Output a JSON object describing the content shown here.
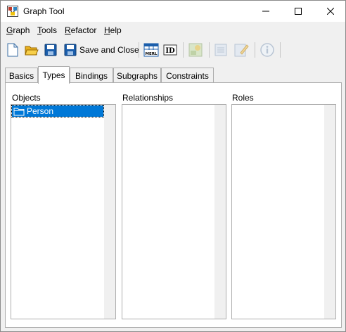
{
  "window": {
    "title": "Graph Tool"
  },
  "menu": [
    {
      "accel": "G",
      "rest": "raph"
    },
    {
      "accel": "T",
      "rest": "ools"
    },
    {
      "accel": "R",
      "rest": "efactor"
    },
    {
      "accel": "H",
      "rest": "elp"
    }
  ],
  "toolbar": {
    "save_close_label": "Save and Close"
  },
  "tabs": [
    "Basics",
    "Types",
    "Bindings",
    "Subgraphs",
    "Constraints"
  ],
  "active_tab": "Types",
  "panel": {
    "objects_label": "Objects",
    "relationships_label": "Relationships",
    "roles_label": "Roles",
    "objects": [
      "Person"
    ],
    "relationships": [],
    "roles": []
  },
  "colors": {
    "selection": "#0078d7",
    "accent_blue": "#1b5eab"
  }
}
